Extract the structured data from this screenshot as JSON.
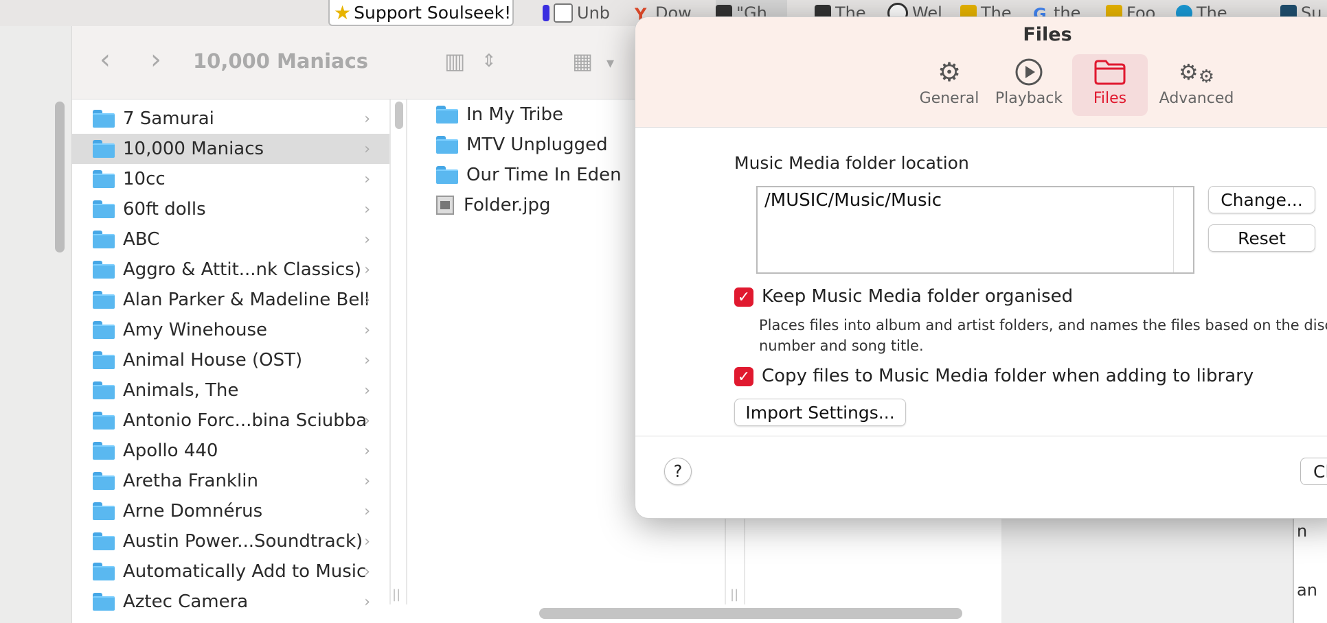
{
  "browser_tabs": {
    "support": "Support Soulseek!",
    "tabs": [
      "Unb",
      "Dow",
      "\"Gh",
      "The",
      "Wel",
      "The",
      "the",
      "Foo",
      "The",
      "Su"
    ]
  },
  "finder": {
    "title": "10,000 Maniacs",
    "column1": [
      "7 Samurai",
      "10,000 Maniacs",
      "10cc",
      "60ft dolls",
      "ABC",
      "Aggro & Attit...nk Classics)",
      "Alan Parker & Madeline Bell",
      "Amy Winehouse",
      "Animal House (OST)",
      "Animals, The",
      "Antonio Forc...bina Sciubba",
      "Apollo 440",
      "Aretha Franklin",
      "Arne Domnérus",
      "Austin Power...Soundtrack)",
      "Automatically Add to Music",
      "Aztec Camera"
    ],
    "selected_index": 1,
    "column2_folders": [
      "In My Tribe",
      "MTV Unplugged",
      "Our Time In Eden"
    ],
    "column2_file": "Folder.jpg"
  },
  "dialog": {
    "title": "Files",
    "tabs": [
      {
        "label": "General",
        "icon": "gear-icon"
      },
      {
        "label": "Playback",
        "icon": "play-icon"
      },
      {
        "label": "Files",
        "icon": "folder-icon"
      },
      {
        "label": "Advanced",
        "icon": "gears-icon"
      }
    ],
    "active_tab": "Files",
    "field_label": "Music Media folder location",
    "path": "/MUSIC/Music/Music",
    "change_button": "Change...",
    "reset_button": "Reset",
    "keep_organised": "Keep Music Media folder organised",
    "keep_desc": "Places files into album and artist folders, and names the files based on the disc number and song title.",
    "copy_files": "Copy files to Music Media folder when adding to library",
    "import_button": "Import Settings...",
    "help": "?",
    "close_button": "Close"
  },
  "colors": {
    "accent": "#e0192f",
    "folder": "#5ab8f0"
  }
}
